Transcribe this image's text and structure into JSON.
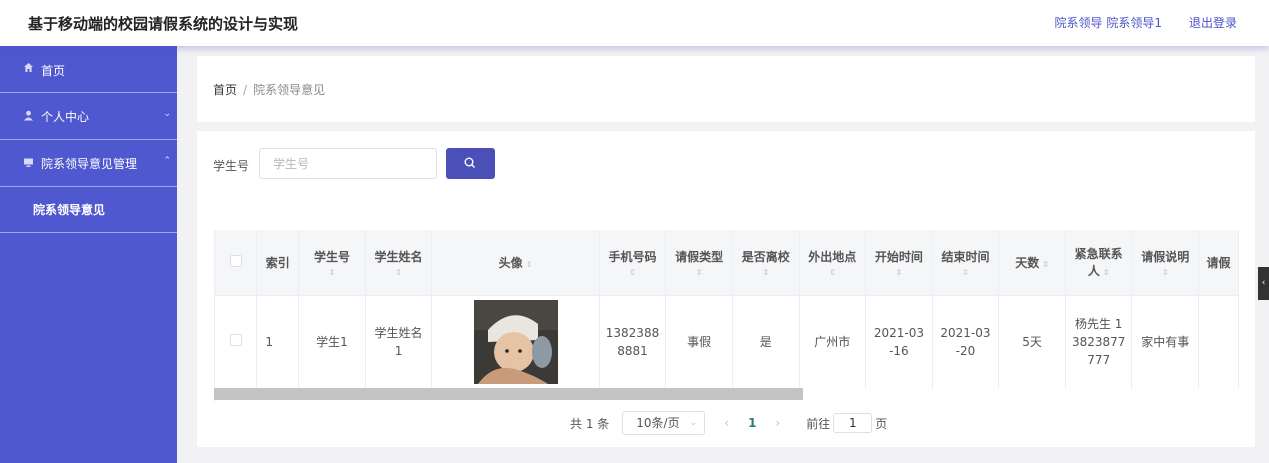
{
  "header": {
    "title": "基于移动端的校园请假系统的设计与实现",
    "user": "院系领导 院系领导1",
    "logout": "退出登录"
  },
  "sidebar": {
    "items": [
      {
        "label": "首页",
        "icon": "home-icon"
      },
      {
        "label": "个人中心",
        "icon": "user-icon"
      },
      {
        "label": "院系领导意见管理",
        "icon": "monitor-icon"
      }
    ],
    "subitem": "院系领导意见"
  },
  "breadcrumb": {
    "home": "首页",
    "separator": "/",
    "current": "院系领导意见"
  },
  "search": {
    "label": "学生号",
    "placeholder": "学生号"
  },
  "table": {
    "headers": [
      "索引",
      "学生号",
      "学生姓名",
      "头像",
      "手机号码",
      "请假类型",
      "是否离校",
      "外出地点",
      "开始时间",
      "结束时间",
      "天数",
      "紧急联系人",
      "请假说明",
      "请假"
    ],
    "sort_glyph": "⇕",
    "rows": [
      {
        "index": "1",
        "student_no": "学生1",
        "student_name": "学生姓名1",
        "phone": "13823888881",
        "leave_type": "事假",
        "left_school": "是",
        "destination": "广州市",
        "start_time": "2021-03-16",
        "end_time": "2021-03-20",
        "days": "5天",
        "emergency_contact": "杨先生 13823877777",
        "leave_note": "家中有事"
      }
    ]
  },
  "pagination": {
    "total": "共 1 条",
    "page_size": "10条/页",
    "current_page": "1",
    "goto_label": "前往",
    "goto_value": "1",
    "page_suffix": "页"
  },
  "colors": {
    "sidebar": "#5058cf",
    "accent": "#4a50b8",
    "title_link": "#4b52c6"
  }
}
